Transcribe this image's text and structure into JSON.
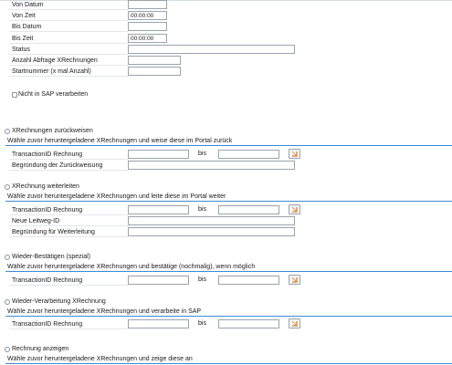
{
  "top_fields": [
    {
      "label": "Von Datum",
      "value": ""
    },
    {
      "label": "Von Zeit",
      "value": "00:00:00"
    },
    {
      "label": "Bis Datum",
      "value": ""
    },
    {
      "label": "Bis Zeit",
      "value": "00:00:00"
    },
    {
      "label": "Status",
      "value": ""
    },
    {
      "label": "Anzahl Abfrage XRechnungen",
      "value": ""
    },
    {
      "label": "Startnummer (x mal Anzahl)",
      "value": ""
    }
  ],
  "checkbox_sap": {
    "label": "Nicht in SAP verarbeiten",
    "checked": false
  },
  "sections": [
    {
      "radio_label": "XRechnungen zurückweisen",
      "description": "Wähle zuvor heruntergeladene XRechnungen und weise diese im Portal zurück",
      "transaction_label": "TransactionID Rechnung",
      "bis_label": "bis",
      "extra_label": "Begründung der Zurückweisung"
    },
    {
      "radio_label": "XRechnung weiterleiten",
      "description": "Wähle zuvor heruntergeladene XRechnungen und leite diese im Portal weiter",
      "transaction_label": "TransactionID Rechnung",
      "bis_label": "bis",
      "extra_label_1": "Neue Leitweg-ID",
      "extra_label_2": "Begründung für Weiterleitung"
    },
    {
      "radio_label": "Wieder-Bestätigen (spezial)",
      "description": "Wähle zuvor heruntergeladene XRechnungen und bestätige (nochmalig), wenn möglich",
      "transaction_label": "TransactionID Rechnung",
      "bis_label": "bis"
    },
    {
      "radio_label": "Wieder-Verarbeitung XRechnung",
      "description": "Wähle zuvor heruntergeladene XRechnungen und verarbeite in SAP",
      "transaction_label": "TransactionID Rechnung",
      "bis_label": "bis"
    },
    {
      "radio_label": "Rechnung anzeigen",
      "description": "Wähle zuvor heruntergeladene XRechnungen und zeige diese an"
    }
  ],
  "colors": {
    "accent_bar": "#3c8bd4",
    "picker_icon": "#e07a1f"
  },
  "icons": {
    "multiple_selection": "arrow-right-icon"
  }
}
